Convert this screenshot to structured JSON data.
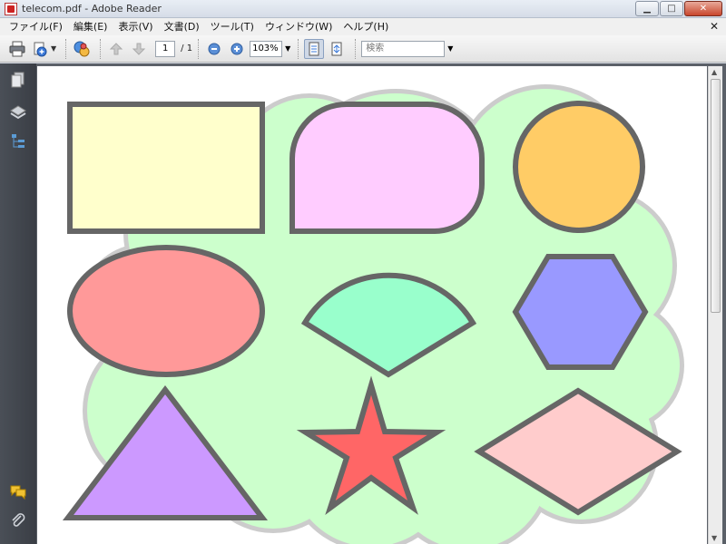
{
  "window": {
    "title": "telecom.pdf - Adobe Reader",
    "minimize": "▁",
    "maximize": "□",
    "close": "✕"
  },
  "menu": {
    "items": [
      "ファイル(F)",
      "編集(E)",
      "表示(V)",
      "文書(D)",
      "ツール(T)",
      "ウィンドウ(W)",
      "ヘルプ(H)"
    ],
    "close_doc": "✕"
  },
  "toolbar": {
    "page_current": "1",
    "page_total": "/ 1",
    "zoom": "103%",
    "search_placeholder": "検索"
  },
  "colors": {
    "cloud": "#ccffcc",
    "cloud_stroke": "#cccccc",
    "shape_stroke": "#666666",
    "rectangle": "#ffffcc",
    "rounded_rectangle": "#ffccff",
    "circle": "#ffcc66",
    "ellipse": "#ff9999",
    "sector": "#99ffcc",
    "hexagon": "#9999ff",
    "triangle": "#cc99ff",
    "star": "#ff6666",
    "diamond": "#ffcccc"
  }
}
